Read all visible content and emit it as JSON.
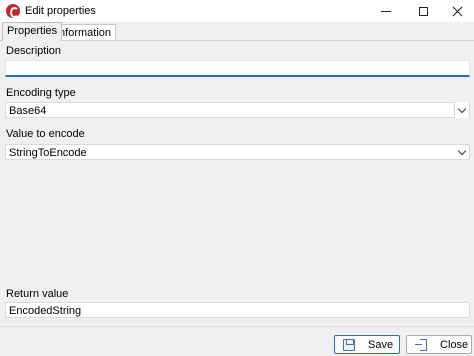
{
  "window": {
    "title": "Edit properties",
    "icon": "app-logo-icon"
  },
  "tabs": [
    {
      "label": "Properties",
      "active": true
    },
    {
      "label": "Information",
      "active": false
    }
  ],
  "form": {
    "description_label": "Description",
    "description_value": "",
    "encoding_label": "Encoding type",
    "encoding_value": "Base64",
    "value_label": "Value to encode",
    "value_value": "StringToEncode",
    "return_label": "Return value",
    "return_value": "EncodedString"
  },
  "buttons": {
    "save_label": "Save",
    "close_label": "Close"
  },
  "colors": {
    "accent": "#1e6fc7",
    "app_icon": "#c62828"
  }
}
